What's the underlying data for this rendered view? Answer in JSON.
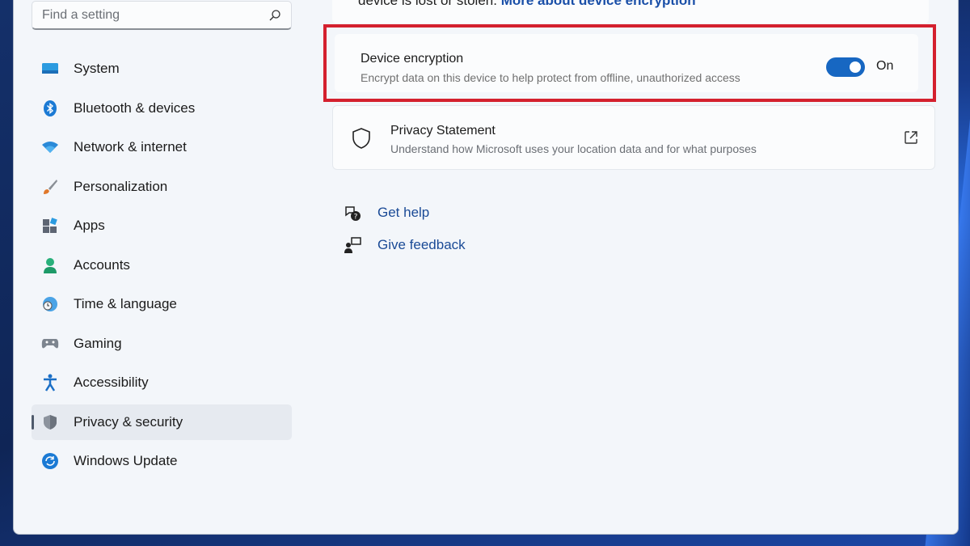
{
  "search": {
    "placeholder": "Find a setting"
  },
  "sidebar": {
    "items": [
      {
        "label": "System",
        "icon": "system-icon"
      },
      {
        "label": "Bluetooth & devices",
        "icon": "bluetooth-icon"
      },
      {
        "label": "Network & internet",
        "icon": "wifi-icon"
      },
      {
        "label": "Personalization",
        "icon": "brush-icon"
      },
      {
        "label": "Apps",
        "icon": "apps-icon"
      },
      {
        "label": "Accounts",
        "icon": "account-icon"
      },
      {
        "label": "Time & language",
        "icon": "globe-clock-icon"
      },
      {
        "label": "Gaming",
        "icon": "gamepad-icon"
      },
      {
        "label": "Accessibility",
        "icon": "accessibility-icon"
      },
      {
        "label": "Privacy & security",
        "icon": "shield-icon",
        "active": true
      },
      {
        "label": "Windows Update",
        "icon": "update-icon"
      }
    ]
  },
  "main": {
    "top_text": "device is lost or stolen.",
    "top_link": "More about device encryption",
    "encryption": {
      "title": "Device encryption",
      "description": "Encrypt data on this device to help protect from offline, unauthorized access",
      "toggle_label": "On",
      "toggle_on": true
    },
    "privacy": {
      "title": "Privacy Statement",
      "description": "Understand how Microsoft uses your location data and for what purposes"
    },
    "help": {
      "get_help": "Get help",
      "give_feedback": "Give feedback"
    }
  },
  "colors": {
    "accent": "#1767c2",
    "highlight": "#d4202e",
    "link": "#1a4fa8"
  }
}
